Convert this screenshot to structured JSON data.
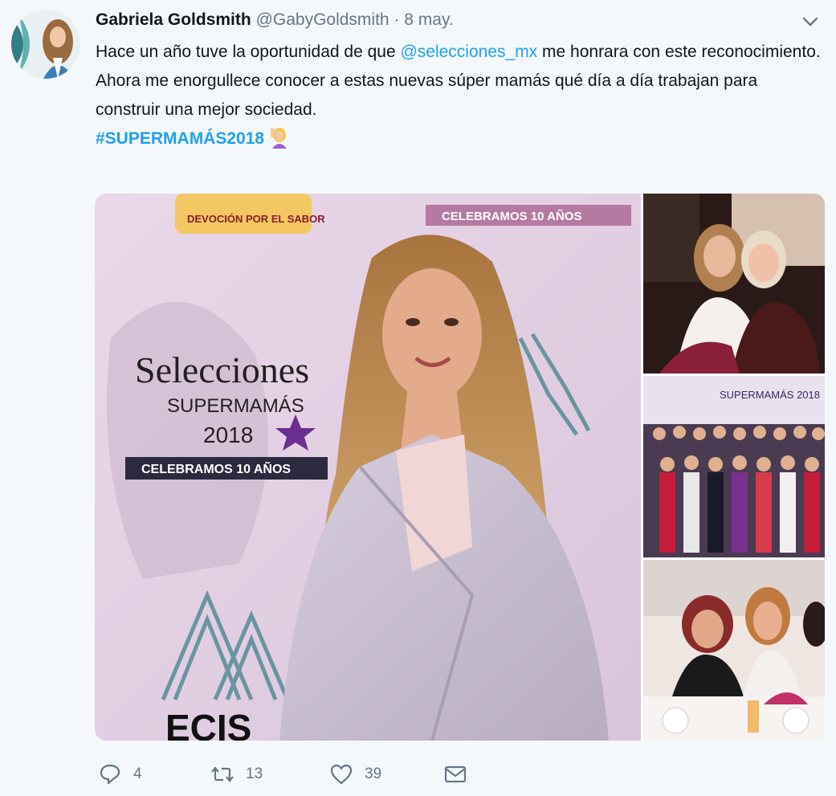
{
  "tweet": {
    "author_name": "Gabriela Goldsmith",
    "handle": "@GabyGoldsmith",
    "separator": "·",
    "date": "8 may.",
    "line1_before": "Hace un año tuve la oportunidad de que ",
    "mention": "@selecciones_mx",
    "line1_after": " me honrara con este reconocimiento.",
    "line2": "Ahora me enorgullece conocer a estas nuevas súper mamás qué día a día trabajan para construir una mejor sociedad.",
    "hashtag": "#SUPERMAMÁS2018",
    "emoji_icon": "woman-raising-hand-emoji"
  },
  "media": {
    "main_photo": {
      "brand": "Selecciones",
      "subtitle": "SUPERMAMÁS",
      "year": "2018",
      "banner": "CELEBRAMOS 10 AÑOS",
      "top_banner": "CELEBRAMOS 10 AÑOS",
      "top_slogan": "DEVOCIÓN POR EL SABOR",
      "sponsor": "ECIS"
    },
    "photo_b_text": "SUPERMAMÁS 2018"
  },
  "actions": {
    "reply_count": "4",
    "retweet_count": "13",
    "like_count": "39"
  },
  "colors": {
    "link": "#1da1f2",
    "secondary": "#657786",
    "background": "#f5f8fa"
  }
}
